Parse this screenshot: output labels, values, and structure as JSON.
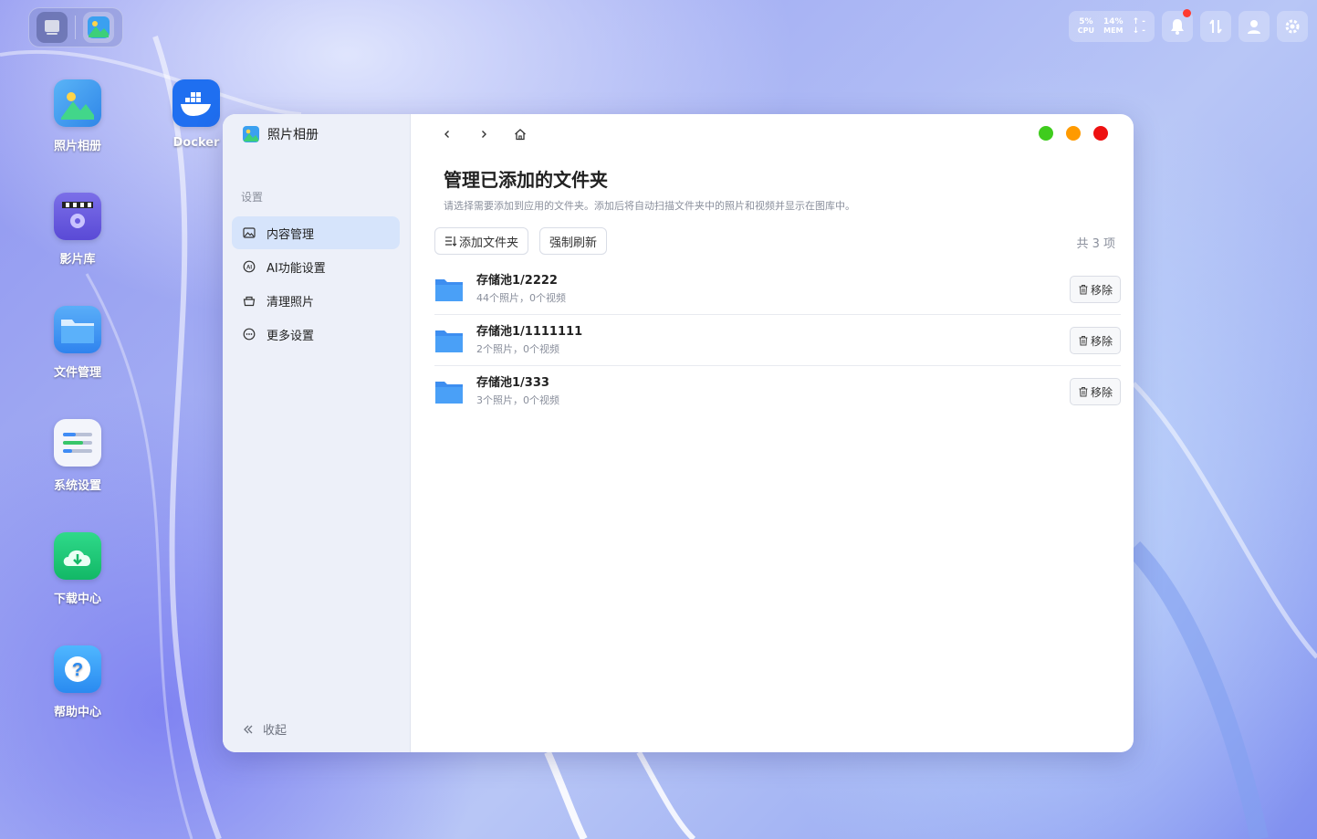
{
  "desktop": {
    "icons": [
      {
        "label": "照片相册",
        "icon": "photos-icon"
      },
      {
        "label": "Docker",
        "icon": "docker-icon"
      },
      {
        "label": "影片库",
        "icon": "movie-library-icon"
      },
      {
        "label": "文件管理",
        "icon": "folder-icon"
      },
      {
        "label": "系统设置",
        "icon": "settings-sliders-icon"
      },
      {
        "label": "下载中心",
        "icon": "download-cloud-icon"
      },
      {
        "label": "帮助中心",
        "icon": "help-icon"
      }
    ]
  },
  "status": {
    "cpu_value": "5%",
    "cpu_label": "CPU",
    "mem_value": "14%",
    "mem_label": "MEM",
    "upload": "↑ -",
    "download": "↓ -",
    "notification_dot_color": "#ff3b30"
  },
  "window": {
    "app_title": "照片相册",
    "section_label": "设置",
    "nav": [
      {
        "label": "内容管理",
        "icon": "image-icon",
        "active": true
      },
      {
        "label": "AI功能设置",
        "icon": "ai-icon",
        "active": false
      },
      {
        "label": "清理照片",
        "icon": "basket-icon",
        "active": false
      },
      {
        "label": "更多设置",
        "icon": "more-icon",
        "active": false
      }
    ],
    "collapse_label": "收起",
    "traffic_colors": {
      "green": "#3fcc1d",
      "orange": "#ff9a00",
      "red": "#ee1111"
    },
    "page_title": "管理已添加的文件夹",
    "page_desc": "请选择需要添加到应用的文件夹。添加后将自动扫描文件夹中的照片和视频并显示在图库中。",
    "add_folder_label": "添加文件夹",
    "force_refresh_label": "强制刷新",
    "count_label": "共 3 项",
    "folders": [
      {
        "name": "存储池1/2222",
        "meta": "44个照片，0个视频",
        "remove_label": "移除"
      },
      {
        "name": "存储池1/1111111",
        "meta": "2个照片，0个视频",
        "remove_label": "移除"
      },
      {
        "name": "存储池1/333",
        "meta": "3个照片，0个视频",
        "remove_label": "移除"
      }
    ]
  }
}
